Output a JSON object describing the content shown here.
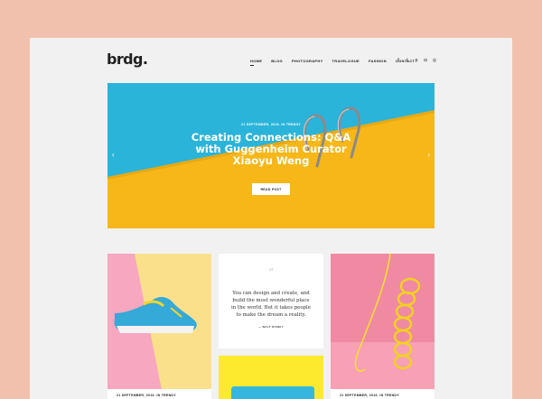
{
  "site": {
    "logo": "brdg."
  },
  "nav": {
    "items": [
      {
        "label": "HOME"
      },
      {
        "label": "BLOG"
      },
      {
        "label": "PHOTOGRAPHY"
      },
      {
        "label": "TRAVELOGUE"
      },
      {
        "label": "FASHION"
      },
      {
        "label": "CONTACT"
      }
    ]
  },
  "social": [
    {
      "icon": "facebook-icon",
      "glyph": "f"
    },
    {
      "icon": "twitter-icon",
      "glyph": "t"
    },
    {
      "icon": "pinterest-icon",
      "glyph": "p"
    },
    {
      "icon": "instagram-icon",
      "glyph": "◘"
    },
    {
      "icon": "dribbble-icon",
      "glyph": "◎"
    }
  ],
  "hero": {
    "meta": "21 SEPTEMBER, 2016. IN TRENDY",
    "title": "Creating Connections: Q&A with Guggenheim Curator Xiaoyu Weng",
    "button": "READ POST",
    "prev_glyph": "‹",
    "next_glyph": "›",
    "colors": {
      "water": "#2ab4da",
      "ground": "#f7b718"
    }
  },
  "cards": {
    "card1": {
      "meta": "21 SEPTEMBER, 2016. IN TRENDY"
    },
    "quote": {
      "mark": "“",
      "text": "You can design and create, and build the most wonderful place in the world. But it takes people to make the dream a reality.",
      "author": "— WALT DISNEY"
    },
    "card3": {
      "meta": "21 SEPTEMBER, 2016. IN TRENDY"
    }
  },
  "colors": {
    "background": "#f2c1ad",
    "page": "#f1f1f1",
    "accent_yellow": "#fdea2e"
  }
}
